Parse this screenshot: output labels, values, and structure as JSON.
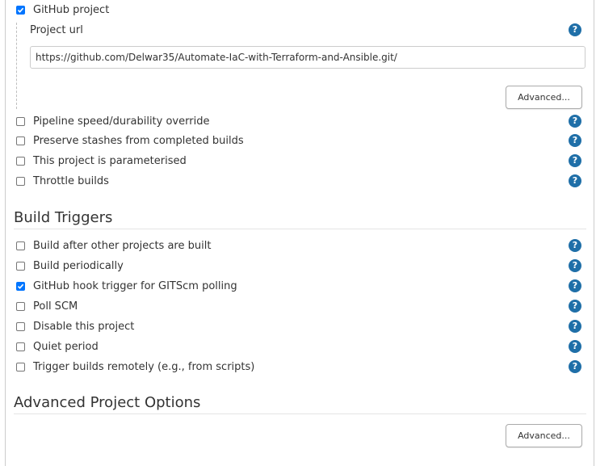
{
  "github_project": {
    "label": "GitHub project",
    "checked": true,
    "project_url_label": "Project url",
    "project_url_value": "https://github.com/Delwar35/Automate-IaC-with-Terraform-and-Ansible.git/",
    "advanced_label": "Advanced..."
  },
  "general_options": [
    {
      "label": "Pipeline speed/durability override",
      "checked": false
    },
    {
      "label": "Preserve stashes from completed builds",
      "checked": false
    },
    {
      "label": "This project is parameterised",
      "checked": false
    },
    {
      "label": "Throttle builds",
      "checked": false
    }
  ],
  "build_triggers": {
    "title": "Build Triggers",
    "items": [
      {
        "label": "Build after other projects are built",
        "checked": false
      },
      {
        "label": "Build periodically",
        "checked": false
      },
      {
        "label": "GitHub hook trigger for GITScm polling",
        "checked": true
      },
      {
        "label": "Poll SCM",
        "checked": false
      },
      {
        "label": "Disable this project",
        "checked": false
      },
      {
        "label": "Quiet period",
        "checked": false
      },
      {
        "label": "Trigger builds remotely (e.g., from scripts)",
        "checked": false
      }
    ]
  },
  "advanced_project_options": {
    "title": "Advanced Project Options",
    "advanced_label": "Advanced..."
  },
  "help_glyph": "?",
  "icons": {
    "help": "help-icon",
    "checkbox": "checkbox"
  },
  "colors": {
    "help": "#1f6fa8",
    "checkbox_checked": "#0075ff",
    "rule": "#e4e4e4"
  }
}
